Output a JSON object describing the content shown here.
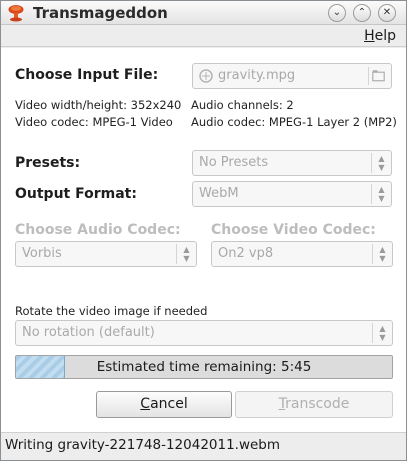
{
  "window": {
    "title": "Transmageddon",
    "minimize_glyph": "⌄",
    "maximize_glyph": "⌃",
    "close_glyph": "✕"
  },
  "menubar": {
    "help_accel": "H",
    "help_rest": "elp"
  },
  "input": {
    "heading": "Choose Input File:",
    "file_name": "gravity.mpg",
    "video_size_label": "Video width/height: 352x240",
    "video_codec_label": "Video codec: MPEG-1 Video",
    "audio_channels_label": "Audio channels: 2",
    "audio_codec_label": "Audio codec: MPEG-1 Layer 2 (MP2)"
  },
  "presets": {
    "heading": "Presets:",
    "value": "No Presets"
  },
  "output_format": {
    "heading": "Output Format:",
    "value": "WebM"
  },
  "audio_codec": {
    "heading": "Choose Audio Codec:",
    "value": "Vorbis"
  },
  "video_codec": {
    "heading": "Choose Video Codec:",
    "value": "On2 vp8"
  },
  "rotation": {
    "label": "Rotate the video image if needed",
    "value": "No rotation (default)"
  },
  "progress": {
    "text": "Estimated time remaining: 5:45",
    "fraction": 0.13
  },
  "buttons": {
    "cancel_accel": "C",
    "cancel_rest": "ancel",
    "transcode_accel": "T",
    "transcode_rest": "ranscode"
  },
  "status": {
    "text": "Writing gravity-221748-12042011.webm"
  },
  "colors": {
    "progress_fill": "#b5d5ea",
    "disabled_text": "#bdbdbd"
  }
}
